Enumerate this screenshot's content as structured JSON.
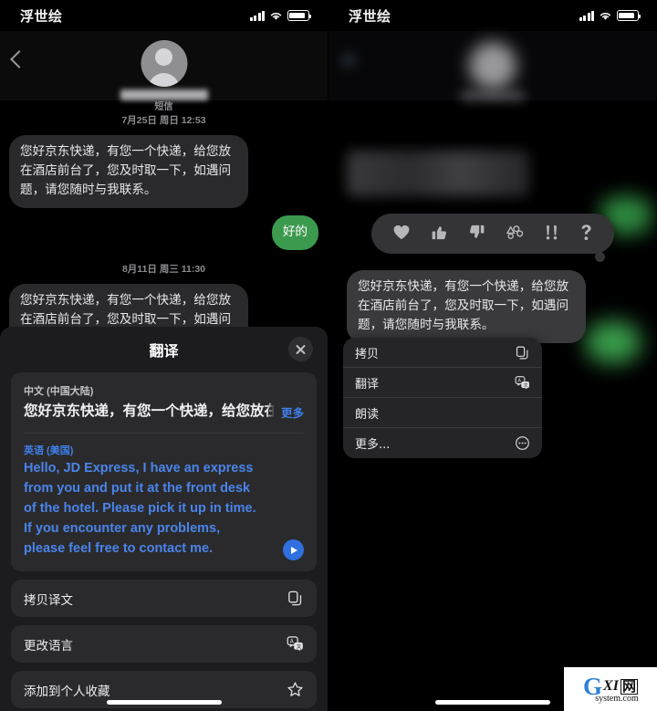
{
  "status_bar": {
    "carrier": "浮世绘",
    "signal_icon": "cellular-signal-icon",
    "wifi_icon": "wifi-icon",
    "battery_icon": "battery-icon"
  },
  "left_screen": {
    "nav": {
      "back_icon": "back-chevron-icon",
      "avatar_icon": "contact-avatar-icon",
      "contact_name_redacted": ""
    },
    "conversation": {
      "groups": [
        {
          "service_label": "短信",
          "timestamp": "7月25日 周日 12:53",
          "messages": [
            {
              "direction": "in",
              "text": "您好京东快递，有您一个快递，给您放在酒店前台了，您及时取一下，如遇问题，请您随时与我联系。"
            },
            {
              "direction": "out",
              "text": "好的"
            }
          ]
        },
        {
          "service_label": "",
          "timestamp": "8月11日 周三 11:30",
          "messages": [
            {
              "direction": "in",
              "text": "您好京东快递，有您一个快递，给您放在酒店前台了，您及时取一下，如遇问题，请您随时与我联系。"
            }
          ]
        }
      ]
    },
    "translate_sheet": {
      "title": "翻译",
      "close_icon": "close-icon",
      "source_language": "中文 (中国大陆)",
      "source_text": "您好京东快递，有您一个快递，给您放在酒店前台了，",
      "more_label": "更多",
      "target_language": "英语 (美国)",
      "target_text": "Hello, JD Express, I have an express from you and put it at the front desk of the hotel. Please pick it up in time. If you encounter any problems, please feel free to contact me.",
      "play_icon": "play-icon",
      "actions": [
        {
          "label": "拷贝译文",
          "icon": "copy-icon"
        },
        {
          "label": "更改语言",
          "icon": "translate-language-icon"
        },
        {
          "label": "添加到个人收藏",
          "icon": "star-icon"
        }
      ]
    }
  },
  "right_screen": {
    "nav": {
      "back_icon": "back-chevron-icon",
      "avatar_icon": "contact-avatar-icon"
    },
    "reaction_bar": {
      "reactions": [
        {
          "name": "heart-reaction-icon",
          "glyph": "♥"
        },
        {
          "name": "thumbs-up-reaction-icon",
          "glyph": "👍"
        },
        {
          "name": "thumbs-down-reaction-icon",
          "glyph": "👎"
        },
        {
          "name": "haha-reaction-icon",
          "glyph": "🅗🅐"
        },
        {
          "name": "exclamation-reaction-icon",
          "glyph": "‼"
        },
        {
          "name": "question-reaction-icon",
          "glyph": "？"
        }
      ]
    },
    "focused_message": "您好京东快递，有您一个快递，给您放在酒店前台了，您及时取一下，如遇问题，请您随时与我联系。",
    "context_menu": [
      {
        "label": "拷贝",
        "icon": "copy-icon"
      },
      {
        "label": "翻译",
        "icon": "translate-language-icon"
      },
      {
        "label": "朗读",
        "icon": ""
      },
      {
        "label": "更多...",
        "icon": "more-ellipsis-icon"
      }
    ]
  },
  "watermark": {
    "brand_letter": "G",
    "brand_mid": "XI",
    "brand_cn": "网",
    "domain": "system.com"
  },
  "colors": {
    "outgoing_bubble": "#3c9a4e",
    "incoming_bubble": "#2a2a2c",
    "accent_blue": "#3f7fe8",
    "sheet_bg": "#1c1c1e"
  }
}
